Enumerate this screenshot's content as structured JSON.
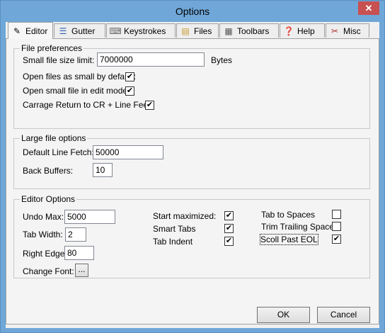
{
  "window": {
    "title": "Options",
    "close_glyph": "✕"
  },
  "tabs": [
    {
      "label": "Editor",
      "icon": "pencil-icon"
    },
    {
      "label": "Gutter",
      "icon": "gutter-icon"
    },
    {
      "label": "Keystrokes",
      "icon": "keyboard-icon"
    },
    {
      "label": "Files",
      "icon": "files-icon"
    },
    {
      "label": "Toolbars",
      "icon": "toolbars-icon"
    },
    {
      "label": "Help",
      "icon": "help-icon"
    },
    {
      "label": "Misc",
      "icon": "tools-icon"
    }
  ],
  "file_prefs": {
    "legend": "File preferences",
    "small_size_label": "Small file size limit:",
    "small_size_value": "7000000",
    "bytes_label": "Bytes",
    "open_small_label": "Open files as small by default:",
    "open_edit_label": "Open small file in edit mode:",
    "crlf_label": "Carrage Return to CR + Line Feed"
  },
  "large_file": {
    "legend": "Large file options",
    "fetch_label": "Default Line Fetch:",
    "fetch_value": "50000",
    "buffers_label": "Back Buffers:",
    "buffers_value": "10"
  },
  "editor_opts": {
    "legend": "Editor Options",
    "undo_label": "Undo Max:",
    "undo_value": "5000",
    "tabwidth_label": "Tab Width:",
    "tabwidth_value": "2",
    "rightedge_label": "Right Edge:",
    "rightedge_value": "80",
    "font_label": "Change Font:",
    "font_btn": "...",
    "start_max_label": "Start maximized:",
    "smart_tabs_label": "Smart Tabs",
    "tab_indent_label": "Tab Indent",
    "tab_spaces_label": "Tab to Spaces",
    "trim_label": "Trim Trailing Spaces",
    "scroll_eol_label": "Scoll Past EOL"
  },
  "checks": {
    "open_small": "✔",
    "open_edit": "✔",
    "crlf": "✔",
    "start_max": "✔",
    "smart_tabs": "✔",
    "tab_indent": "✔",
    "tab_spaces": "",
    "trim": "",
    "scroll_eol": "✔"
  },
  "buttons": {
    "ok": "OK",
    "cancel": "Cancel"
  }
}
